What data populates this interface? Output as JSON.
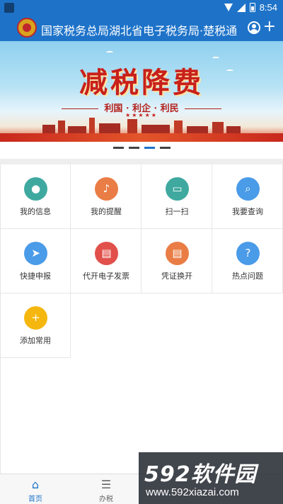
{
  "status_bar": {
    "time": "8:54"
  },
  "header": {
    "title": "国家税务总局湖北省电子税务局·楚税通",
    "add_label": "+"
  },
  "banner": {
    "headline": "减税降费",
    "subline": "利国 · 利企 · 利民",
    "stars": "★★★★★",
    "slides": 4,
    "active_slide": 3
  },
  "grid": {
    "items": [
      {
        "label": "我的信息",
        "icon": "user-info-icon",
        "glyph": "●",
        "color": "#3fa9a0"
      },
      {
        "label": "我的提醒",
        "icon": "bell-icon",
        "glyph": "♪",
        "color": "#e97d45"
      },
      {
        "label": "扫一扫",
        "icon": "scan-icon",
        "glyph": "▭",
        "color": "#3fa9a0"
      },
      {
        "label": "我要查询",
        "icon": "query-icon",
        "glyph": "⌕",
        "color": "#4a9be8"
      },
      {
        "label": "快捷申报",
        "icon": "send-icon",
        "glyph": "➤",
        "color": "#4a9be8"
      },
      {
        "label": "代开电子发票",
        "icon": "invoice-icon",
        "glyph": "▤",
        "color": "#e2504b"
      },
      {
        "label": "凭证换开",
        "icon": "document-icon",
        "glyph": "▤",
        "color": "#e97d45"
      },
      {
        "label": "热点问题",
        "icon": "question-icon",
        "glyph": "?",
        "color": "#4a9be8"
      },
      {
        "label": "添加常用",
        "icon": "add-icon",
        "glyph": "+",
        "color": "#f5b70f"
      }
    ]
  },
  "bottom_nav": {
    "items": [
      {
        "label": "首页",
        "icon": "home-icon",
        "glyph": "⌂",
        "active": true
      },
      {
        "label": "办税",
        "icon": "list-icon",
        "glyph": "☰",
        "active": false
      }
    ]
  },
  "watermark": {
    "brand": "592软件园",
    "url": "www.592xiazai.com"
  }
}
